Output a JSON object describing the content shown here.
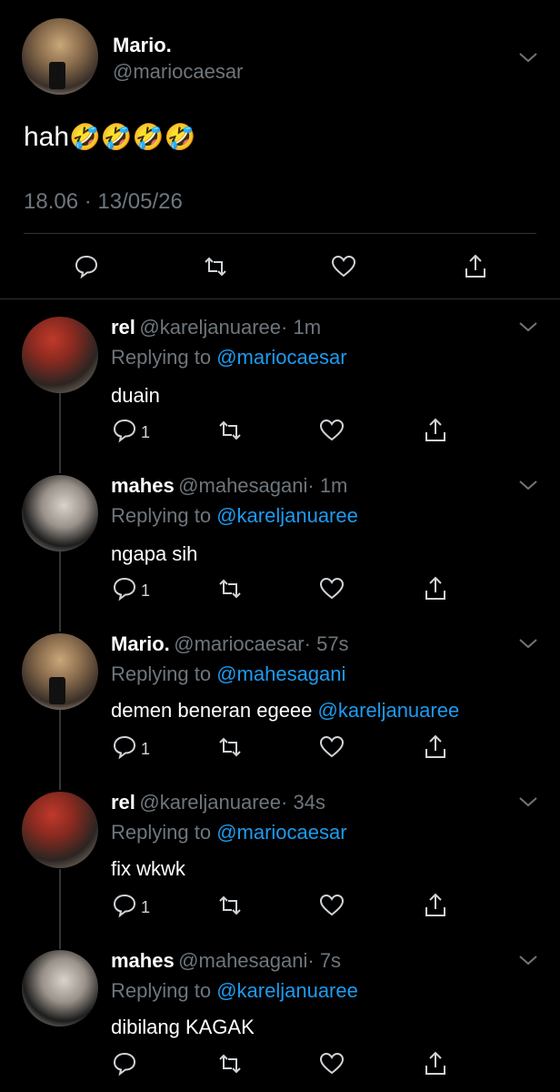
{
  "main_tweet": {
    "name": "Mario.",
    "handle": "@mariocaesar",
    "text": "hah",
    "emoji": "🤣🤣🤣🤣",
    "timestamp": "18.06 · 13/05/26"
  },
  "replies": [
    {
      "name": "rel",
      "handle": "@kareljanuaree",
      "time": "· 1m",
      "replying_label": "Replying to",
      "replying_to": "@mariocaesar",
      "text": "duain",
      "reply_count": "1"
    },
    {
      "name": "mahes",
      "handle": "@mahesagani",
      "time": "· 1m",
      "replying_label": "Replying to",
      "replying_to": "@kareljanuaree",
      "text": "ngapa sih",
      "reply_count": "1"
    },
    {
      "name": "Mario.",
      "handle": "@mariocaesar",
      "time": "· 57s",
      "replying_label": "Replying to",
      "replying_to": "@mahesagani",
      "text": "demen beneran egeee",
      "mention": "@kareljanuaree",
      "reply_count": "1"
    },
    {
      "name": "rel",
      "handle": "@kareljanuaree",
      "time": "· 34s",
      "replying_label": "Replying to",
      "replying_to": "@mariocaesar",
      "text": "fix wkwk",
      "reply_count": "1"
    },
    {
      "name": "mahes",
      "handle": "@mahesagani",
      "time": "· 7s",
      "replying_label": "Replying to",
      "replying_to": "@kareljanuaree",
      "text": "dibilang KAGAK",
      "reply_count": ""
    }
  ],
  "icons": [
    "chevron-down-icon",
    "reply-icon",
    "retweet-icon",
    "like-icon",
    "share-icon"
  ],
  "colors": {
    "background": "#000000",
    "muted": "#6e767d",
    "link": "#1d9bf0",
    "divider": "#2f3336"
  }
}
